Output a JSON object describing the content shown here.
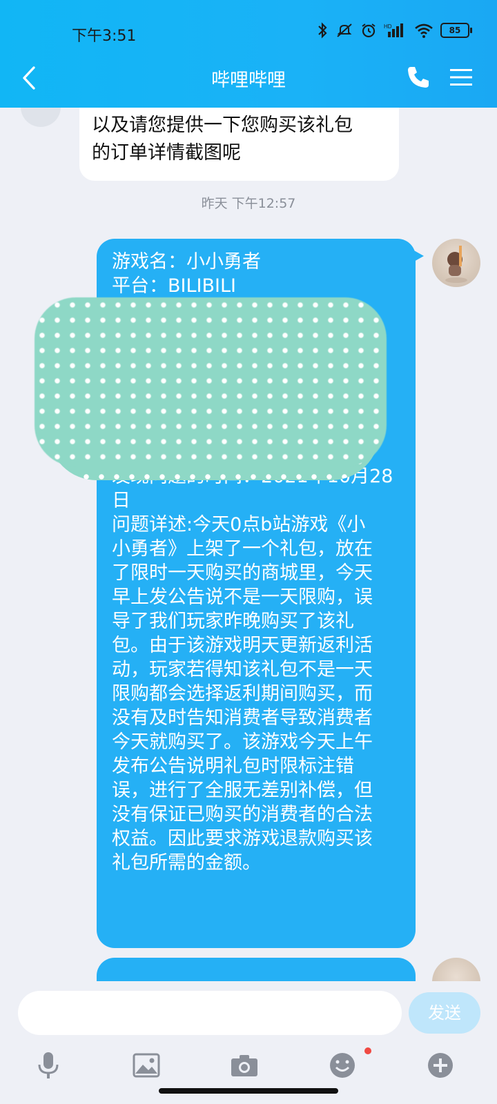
{
  "status": {
    "time": "下午3:51",
    "battery": "85"
  },
  "header": {
    "title": "哔哩哔哩"
  },
  "messages": {
    "incoming": {
      "lines": [
        "以及请您提供一下您购买该礼包",
        "的订单详情截图呢"
      ]
    },
    "timestamp": "昨天 下午12:57",
    "outgoing": {
      "game_line": "游戏名：小小勇者",
      "platform_line": "平台：BILIBILI",
      "body_lines": [
        "发现问题的时间：2021年10月28",
        "日",
        "问题详述:今天0点b站游戏《小",
        "小勇者》上架了一个礼包，放在",
        "了限时一天购买的商城里，今天",
        "早上发公告说不是一天限购，误",
        "导了我们玩家昨晚购买了该礼",
        "包。由于该游戏明天更新返利活",
        "动，玩家若得知该礼包不是一天",
        "限购都会选择返利期间购买，而",
        "没有及时告知消费者导致消费者",
        "今天就购买了。该游戏今天上午",
        "发布公告说明礼包时限标注错",
        "误，进行了全服无差别补偿，但",
        "没有保证已购买的消费者的合法",
        "权益。因此要求游戏退款购买该",
        "礼包所需的金额。"
      ]
    }
  },
  "input": {
    "placeholder": "",
    "value": "",
    "send_label": "发送"
  },
  "colors": {
    "header": "#1ab2f7",
    "bubble_out": "#25b0f5",
    "send_disabled": "#bfe6fb"
  }
}
